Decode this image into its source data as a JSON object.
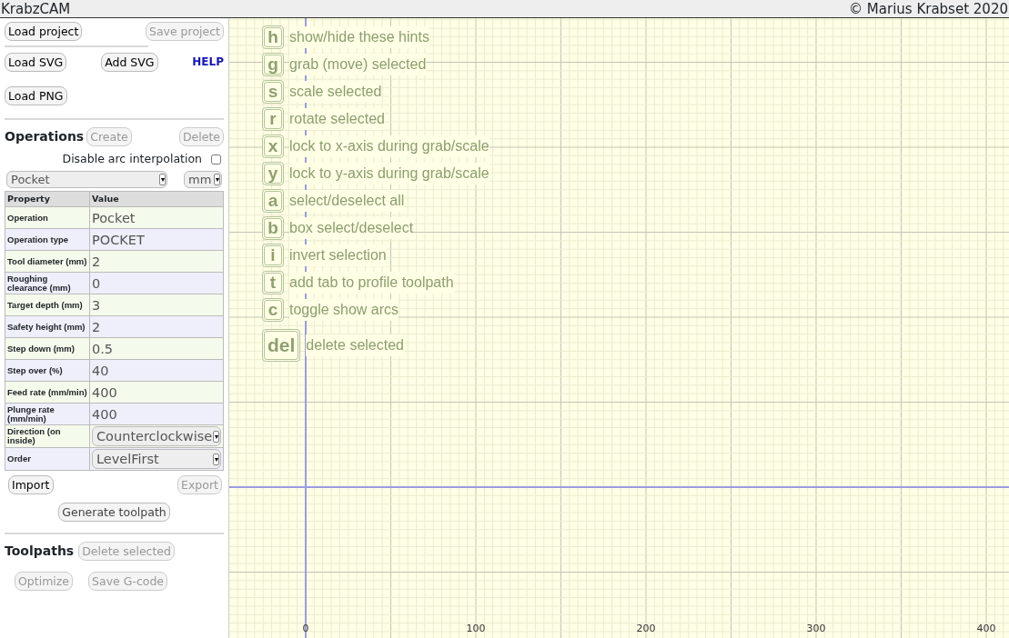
{
  "title": "KrabzCAM",
  "copyright": "© Marius Krabset 2020",
  "project_buttons": [
    {
      "label": "Load project",
      "disabled": false
    },
    {
      "label": "Save project",
      "disabled": true
    }
  ],
  "file_buttons": [
    {
      "label": "Load SVG",
      "disabled": false
    },
    {
      "label": "Add SVG",
      "disabled": false
    },
    {
      "label": "Load PNG",
      "disabled": false
    }
  ],
  "help": "HELP",
  "operations": {
    "heading": "Operations",
    "buttons": [
      {
        "label": "Create",
        "disabled": true
      },
      {
        "label": "Delete",
        "disabled": true
      }
    ],
    "arc_option": {
      "label": "Disable arc interpolation",
      "checked": false
    },
    "operation_select": "Pocket",
    "unit_select": "mm",
    "table": {
      "columns": [
        "Property",
        "Value"
      ],
      "rows": [
        {
          "property": "Operation",
          "value": "Pocket",
          "kind": "input"
        },
        {
          "property": "Operation type",
          "value": "POCKET",
          "kind": "input"
        },
        {
          "property": "Tool diameter (mm)",
          "value": "2",
          "kind": "input"
        },
        {
          "property": "Roughing clearance (mm)",
          "value": "0",
          "kind": "input"
        },
        {
          "property": "Target depth (mm)",
          "value": "3",
          "kind": "input"
        },
        {
          "property": "Safety height (mm)",
          "value": "2",
          "kind": "input"
        },
        {
          "property": "Step down (mm)",
          "value": "0.5",
          "kind": "input"
        },
        {
          "property": "Step over (%)",
          "value": "40",
          "kind": "input"
        },
        {
          "property": "Feed rate (mm/min)",
          "value": "400",
          "kind": "input"
        },
        {
          "property": "Plunge rate (mm/min)",
          "value": "400",
          "kind": "input"
        },
        {
          "property": "Direction (on inside)",
          "value": "Counterclockwise",
          "kind": "select"
        },
        {
          "property": "Order",
          "value": "LevelFirst",
          "kind": "select"
        }
      ]
    },
    "import_export": [
      {
        "label": "Import",
        "disabled": false
      },
      {
        "label": "Export",
        "disabled": true
      }
    ],
    "generate": {
      "label": "Generate toolpath",
      "disabled": false
    }
  },
  "toolpaths": {
    "heading": "Toolpaths",
    "delete": {
      "label": "Delete selected",
      "disabled": true
    },
    "buttons": [
      {
        "label": "Optimize",
        "disabled": true
      },
      {
        "label": "Save G-code",
        "disabled": true
      }
    ]
  },
  "canvas": {
    "hints": [
      {
        "key": "h",
        "text": "show/hide these hints"
      },
      {
        "key": "g",
        "text": "grab (move) selected"
      },
      {
        "key": "s",
        "text": "scale selected"
      },
      {
        "key": "r",
        "text": "rotate selected"
      },
      {
        "key": "x",
        "text": "lock to x-axis during grab/scale"
      },
      {
        "key": "y",
        "text": "lock to y-axis during grab/scale"
      },
      {
        "key": "a",
        "text": "select/deselect all"
      },
      {
        "key": "b",
        "text": "box select/deselect"
      },
      {
        "key": "i",
        "text": "invert selection"
      },
      {
        "key": "t",
        "text": "add tab to profile toolpath"
      },
      {
        "key": "c",
        "text": "toggle show arcs"
      },
      {
        "key": "del",
        "text": "delete selected"
      }
    ],
    "axis_labels": [
      "0",
      "100",
      "200",
      "300",
      "400"
    ]
  }
}
